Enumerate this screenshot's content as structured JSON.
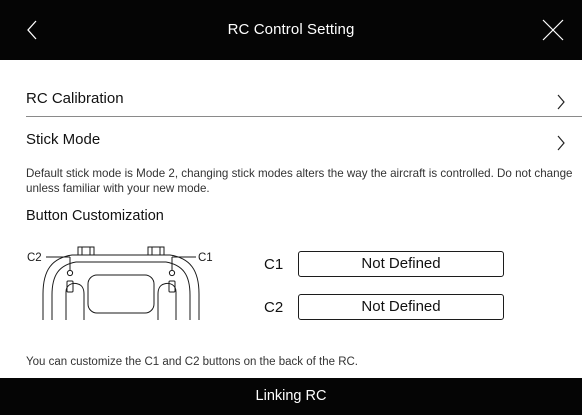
{
  "header": {
    "title": "RC Control Setting",
    "back_icon": "chevron-left-icon",
    "close_icon": "close-icon"
  },
  "menu": {
    "calibration_label": "RC Calibration",
    "stick_mode_label": "Stick Mode",
    "chevron_icon": "chevron-right-icon"
  },
  "stick_mode_description": "Default stick mode is Mode 2, changing stick modes alters the way the aircraft is controlled. Do not change unless familiar with your new mode.",
  "button_customization": {
    "heading": "Button Customization",
    "diagram": {
      "c1_label": "C1",
      "c2_label": "C2"
    },
    "c1": {
      "label": "C1",
      "value": "Not Defined"
    },
    "c2": {
      "label": "C2",
      "value": "Not Defined"
    },
    "note": "You can customize the C1 and C2 buttons on the back of the RC."
  },
  "status_bar": {
    "text": "Linking RC"
  },
  "colors": {
    "bar_background": "#050505",
    "bar_text": "#ffffff",
    "page_background": "#ffffff",
    "text": "#111111",
    "divider": "#8a8a8a"
  }
}
